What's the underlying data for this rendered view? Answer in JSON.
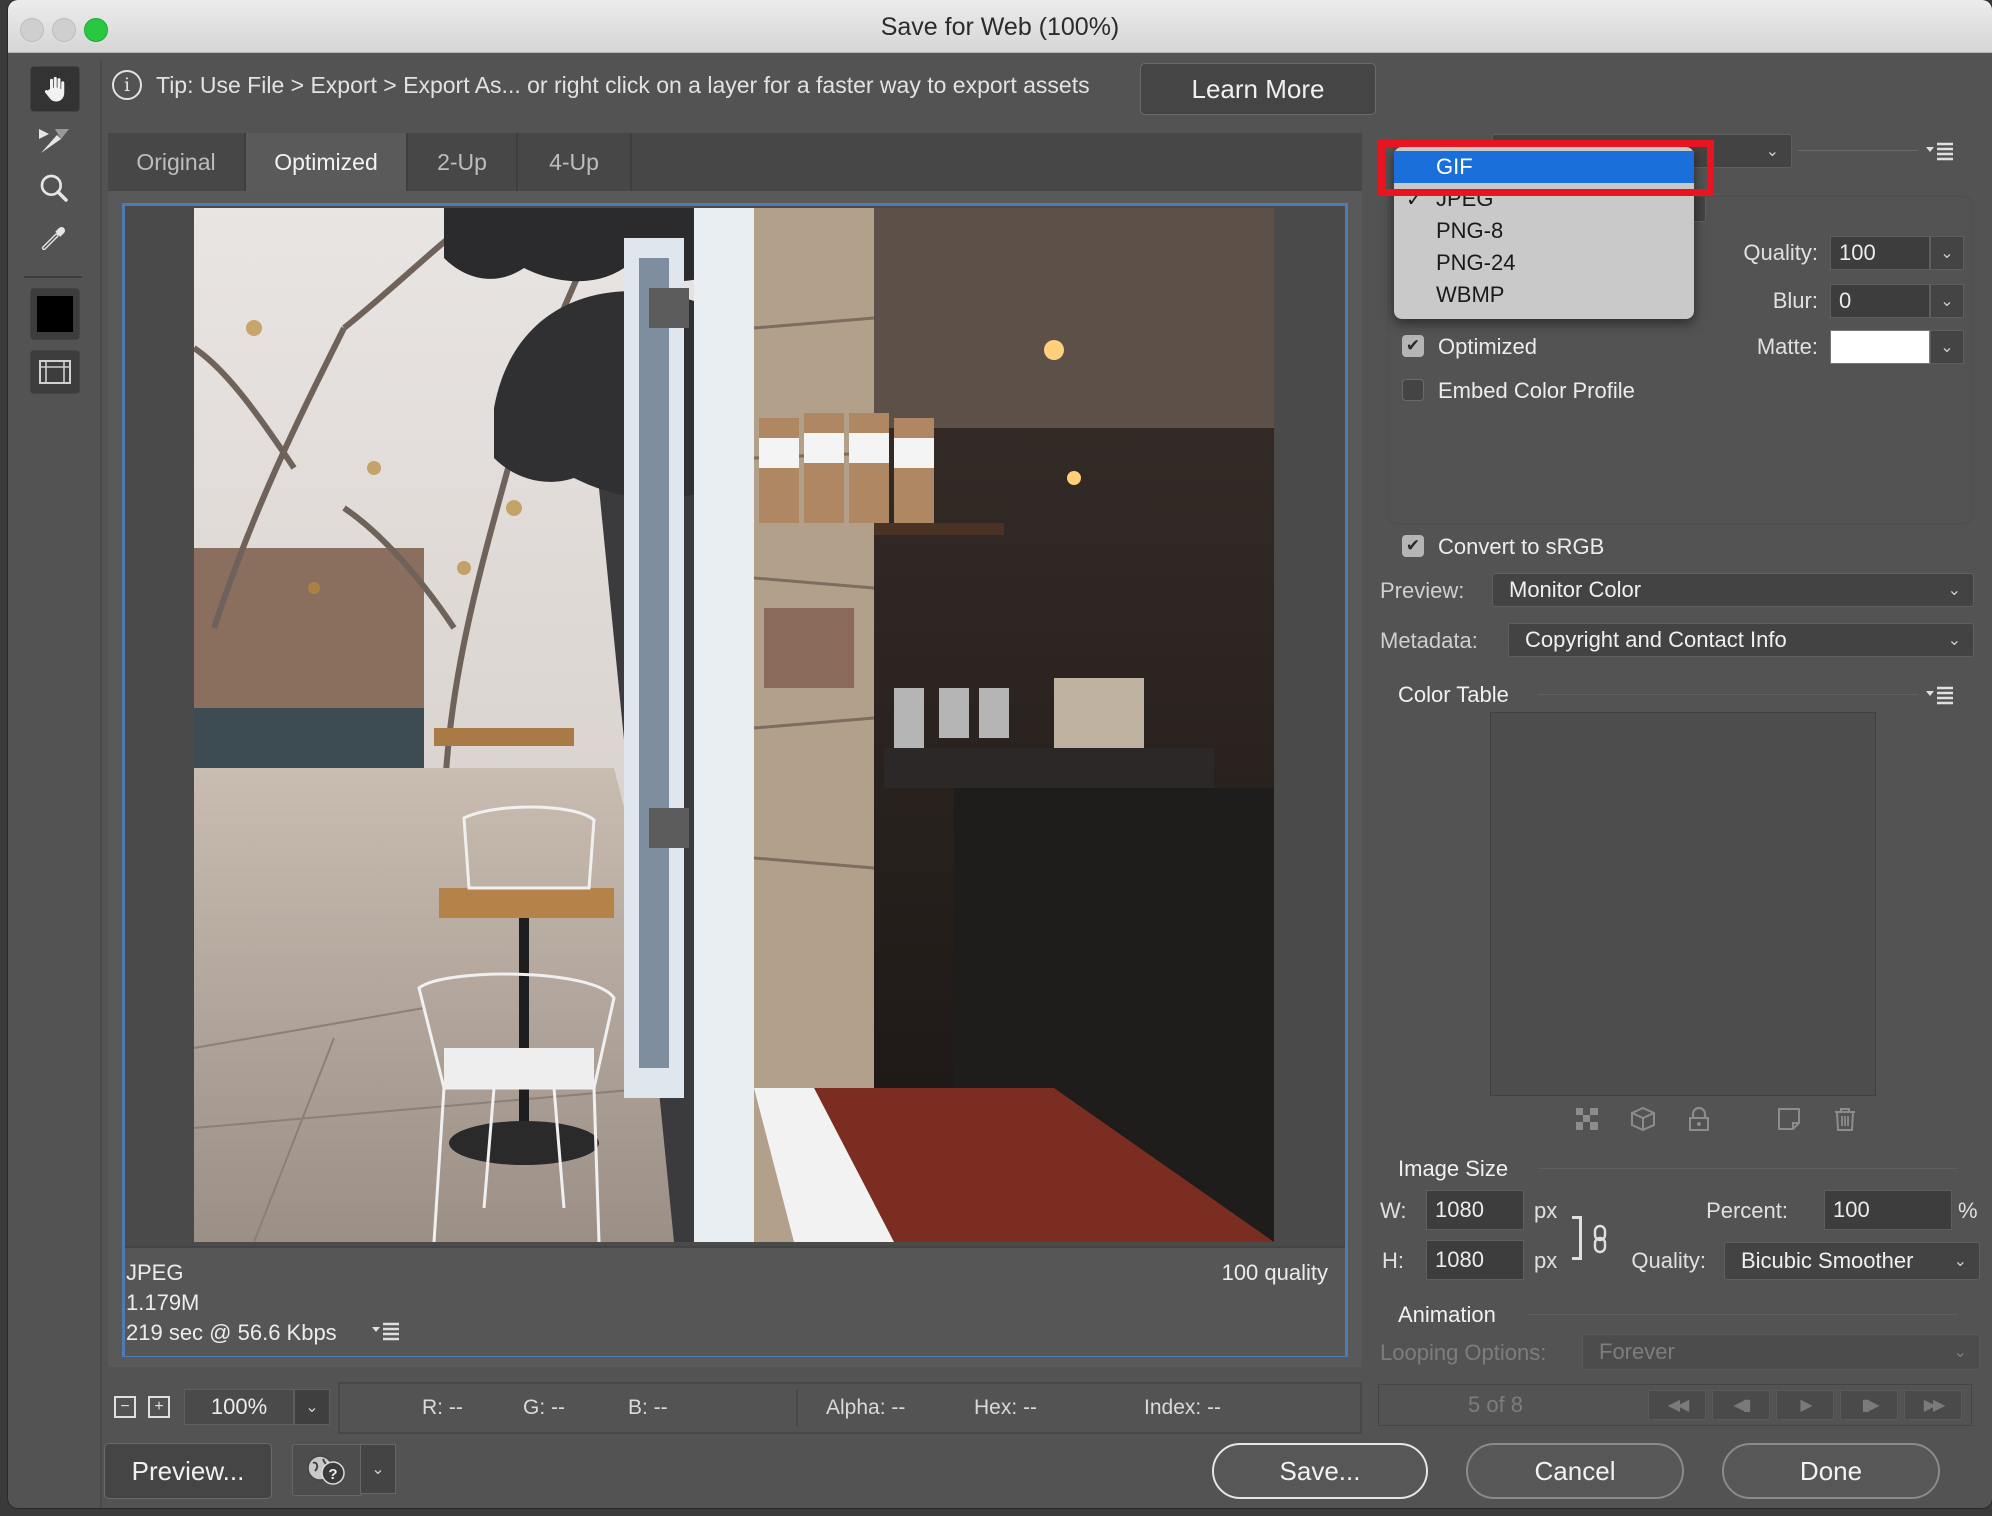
{
  "window": {
    "title": "Save for Web (100%)"
  },
  "tip": {
    "text": "Tip: Use File > Export > Export As...  or right click on a layer for a faster way to export assets",
    "learn_more_label": "Learn More"
  },
  "tools": [
    {
      "name": "hand-tool",
      "active": true
    },
    {
      "name": "slice-select-tool",
      "active": false
    },
    {
      "name": "zoom-tool",
      "active": false
    },
    {
      "name": "eyedropper-tool",
      "active": false
    },
    {
      "name": "eyedropper-color",
      "color": "#000000"
    },
    {
      "name": "toggle-slices-visibility",
      "active": false
    }
  ],
  "view_tabs": [
    {
      "label": "Original",
      "active": false
    },
    {
      "label": "Optimized",
      "active": true
    },
    {
      "label": "2-Up",
      "active": false
    },
    {
      "label": "4-Up",
      "active": false
    }
  ],
  "preview_info": {
    "format": "JPEG",
    "file_size": "1.179M",
    "download_time": "219 sec @ 56.6 Kbps",
    "quality": "100 quality"
  },
  "status_bar": {
    "zoom": "100%",
    "r": "R: --",
    "g": "G: --",
    "b": "B: --",
    "alpha": "Alpha: --",
    "hex": "Hex: --",
    "index": "Index: --"
  },
  "format_menu": {
    "items": [
      {
        "label": "GIF",
        "highlighted": true,
        "checked": false
      },
      {
        "label": "JPEG",
        "highlighted": false,
        "checked": true
      },
      {
        "label": "PNG-8",
        "highlighted": false,
        "checked": false
      },
      {
        "label": "PNG-24",
        "highlighted": false,
        "checked": false
      },
      {
        "label": "WBMP",
        "highlighted": false,
        "checked": false
      }
    ],
    "check_glyph": "✓"
  },
  "settings": {
    "quality_label": "Quality:",
    "quality_value": "100",
    "blur_label": "Blur:",
    "blur_value": "0",
    "matte_label": "Matte:",
    "matte_color": "#ffffff",
    "optimized_label": "Optimized",
    "optimized_checked": true,
    "embed_profile_label": "Embed Color Profile",
    "embed_profile_checked": false,
    "convert_srgb_label": "Convert to sRGB",
    "convert_srgb_checked": true,
    "preview_label": "Preview:",
    "preview_value": "Monitor Color",
    "metadata_label": "Metadata:",
    "metadata_value": "Copyright and Contact Info"
  },
  "color_table": {
    "title": "Color Table",
    "icons": [
      "web-snap-icon",
      "cube-icon",
      "lock-icon",
      "new-color-icon",
      "trash-icon"
    ]
  },
  "image_size": {
    "title": "Image Size",
    "w_label": "W:",
    "w_value": "1080",
    "h_label": "H:",
    "h_value": "1080",
    "unit": "px",
    "percent_label": "Percent:",
    "percent_value": "100",
    "percent_unit": "%",
    "quality_label": "Quality:",
    "quality_value": "Bicubic Smoother"
  },
  "animation": {
    "title": "Animation",
    "looping_label": "Looping Options:",
    "looping_value": "Forever",
    "frame_counter": "5 of 8"
  },
  "buttons": {
    "preview": "Preview...",
    "save": "Save...",
    "cancel": "Cancel",
    "done": "Done"
  },
  "colors": {
    "accent_highlight": "#1a6fdb",
    "annotation_red": "#e8141f",
    "preview_border": "#4e7bb3",
    "panel_bg": "#535353"
  }
}
